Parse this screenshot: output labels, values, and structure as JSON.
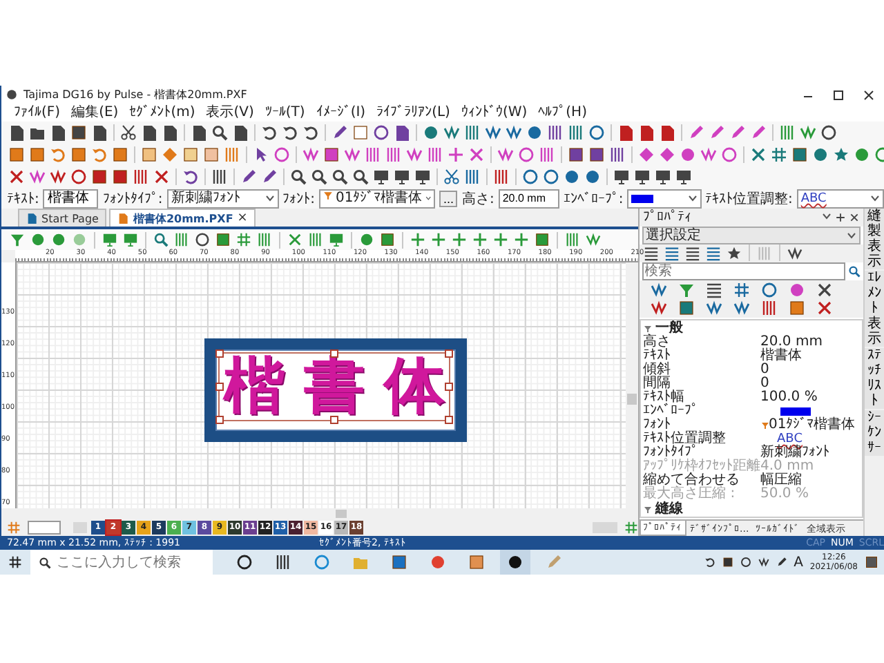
{
  "window": {
    "title": "Tajima DG16 by Pulse - 楷書体20mm.PXF"
  },
  "menu": [
    "ﾌｧｲﾙ(F)",
    "編集(E)",
    "ｾｸﾞﾒﾝﾄ(m)",
    "表示(V)",
    "ﾂｰﾙ(T)",
    "ｲﾒｰｼﾞ(I)",
    "ﾗｲﾌﾞﾗﾘｱﾝ(L)",
    "ｳｨﾝﾄﾞｳ(W)",
    "ﾍﾙﾌﾟ(H)"
  ],
  "text_bar": {
    "text_label": "ﾃｷｽﾄ:",
    "text_value": "楷書体",
    "font_type_label": "ﾌｫﾝﾄﾀｲﾌﾟ:",
    "font_type": "新刺繍ﾌｫﾝﾄ",
    "font_label": "ﾌｫﾝﾄ:",
    "font": "01ﾀｼﾞﾏ楷書体",
    "more": "...",
    "height_label": "高さ:",
    "height": "20.0 mm",
    "envelope_label": "ｴﾝﾍﾞﾛｰﾌﾟ:",
    "align_label": "ﾃｷｽﾄ位置調整:",
    "align_sample": "ABC"
  },
  "tabs": [
    {
      "label": "Start Page",
      "selected": false
    },
    {
      "label": "楷書体20mm.PXF",
      "selected": true,
      "close": "×"
    }
  ],
  "ruler": {
    "x_labels": [
      "20",
      "30",
      "40",
      "50",
      "60",
      "70",
      "80",
      "90",
      "100",
      "110",
      "120",
      "130",
      "140",
      "150",
      "160",
      "170",
      "180",
      "190",
      "200",
      "210"
    ],
    "y_labels": [
      "130",
      "120",
      "110",
      "100",
      "90",
      "80",
      "70"
    ]
  },
  "design": {
    "text": "楷書体",
    "selected": true
  },
  "palette": [
    {
      "label": "1",
      "color": "#1f4e8c",
      "selected": false
    },
    {
      "label": "2",
      "color": "#c0392b",
      "selected": true
    },
    {
      "label": "3",
      "color": "#1e5a4a",
      "selected": false
    },
    {
      "label": "4",
      "color": "#e6a21a",
      "selected": false
    },
    {
      "label": "5",
      "color": "#1c3a5e",
      "selected": false
    },
    {
      "label": "6",
      "color": "#4caf50",
      "selected": false
    },
    {
      "label": "7",
      "color": "#6fc1e0",
      "selected": false
    },
    {
      "label": "8",
      "color": "#5b4a9e",
      "selected": false
    },
    {
      "label": "9",
      "color": "#e8b820",
      "selected": false
    },
    {
      "label": "10",
      "color": "#2d3a2d",
      "selected": false
    },
    {
      "label": "11",
      "color": "#6b3f8f",
      "selected": false
    },
    {
      "label": "12",
      "color": "#222222",
      "selected": false
    },
    {
      "label": "13",
      "color": "#1f5fa8",
      "selected": false
    },
    {
      "label": "14",
      "color": "#4a2030",
      "selected": false
    },
    {
      "label": "15",
      "color": "#f0b8a0",
      "selected": false
    },
    {
      "label": "16",
      "color": "#ffffff",
      "selected": false
    },
    {
      "label": "17",
      "color": "#b8b8b8",
      "selected": false
    },
    {
      "label": "18",
      "color": "#6b4030",
      "selected": false
    }
  ],
  "status_bar": {
    "size": "72.47 mm x 21.52 mm, ｽﾃｯﾁ : 1991",
    "segment": "ｾｸﾞﾒﾝﾄ番号2, ﾃｷｽﾄ",
    "indicators": [
      {
        "label": "CAP",
        "on": false
      },
      {
        "label": "NUM",
        "on": true
      },
      {
        "label": "SCRL",
        "on": false
      }
    ]
  },
  "properties": {
    "title": "ﾌﾟﾛﾊﾟﾃｨ",
    "selector": "選択設定",
    "search_placeholder": "検索",
    "sections": [
      {
        "title": "一般",
        "rows": [
          {
            "kind": "text",
            "name": "高さ",
            "value": "20.0 mm",
            "disabled": false
          },
          {
            "kind": "text",
            "name": "ﾃｷｽﾄ",
            "value": "楷書体",
            "disabled": false
          },
          {
            "kind": "text",
            "name": "傾斜",
            "value": "0",
            "disabled": false
          },
          {
            "kind": "text",
            "name": "間隔",
            "value": "0",
            "disabled": false
          },
          {
            "kind": "text",
            "name": "ﾃｷｽﾄ幅",
            "value": "100.0 %",
            "disabled": false
          },
          {
            "kind": "swatch",
            "name": "ｴﾝﾍﾞﾛｰﾌﾟ",
            "disabled": false
          },
          {
            "kind": "font",
            "name": "ﾌｫﾝﾄ",
            "value": "01ﾀｼﾞﾏ楷書体",
            "disabled": false
          },
          {
            "kind": "sample",
            "name": "ﾃｷｽﾄ位置調整",
            "value": "ABC",
            "disabled": false
          },
          {
            "kind": "text",
            "name": "ﾌｫﾝﾄﾀｲﾌﾟ",
            "value": "新刺繍ﾌｫﾝﾄ",
            "disabled": false
          },
          {
            "kind": "text",
            "name": "ｱｯﾌﾟﾘｹ枠ｵﾌｾｯﾄ距離",
            "value": "4.0 mm",
            "disabled": true
          },
          {
            "kind": "text",
            "name": "縮めて合わせる",
            "value": "幅圧縮",
            "disabled": false
          },
          {
            "kind": "text",
            "name": "最大高さ圧縮 :",
            "value": "50.0 %",
            "disabled": true
          }
        ]
      },
      {
        "title": "縫線"
      }
    ],
    "bottom_tabs": [
      {
        "label": "ﾌﾟﾛﾊﾟﾃｨ",
        "selected": true
      },
      {
        "label": "ﾃﾞｻﾞｲﾝﾌﾟﾛ...",
        "selected": false
      },
      {
        "label": "ﾂｰﾙｶﾞｲﾄﾞ",
        "selected": false
      },
      {
        "label": "全域表示",
        "selected": false
      }
    ],
    "side_tabs": [
      "縫製表示",
      "ｴﾚﾒﾝﾄ表示",
      "ｽﾃｯﾁﾘｽﾄ",
      "ｼｰｹﾝｻｰ"
    ]
  },
  "taskbar": {
    "search_placeholder": "ここに入力して検索",
    "ime": "A",
    "time": "12:26",
    "date": "2021/06/08"
  }
}
